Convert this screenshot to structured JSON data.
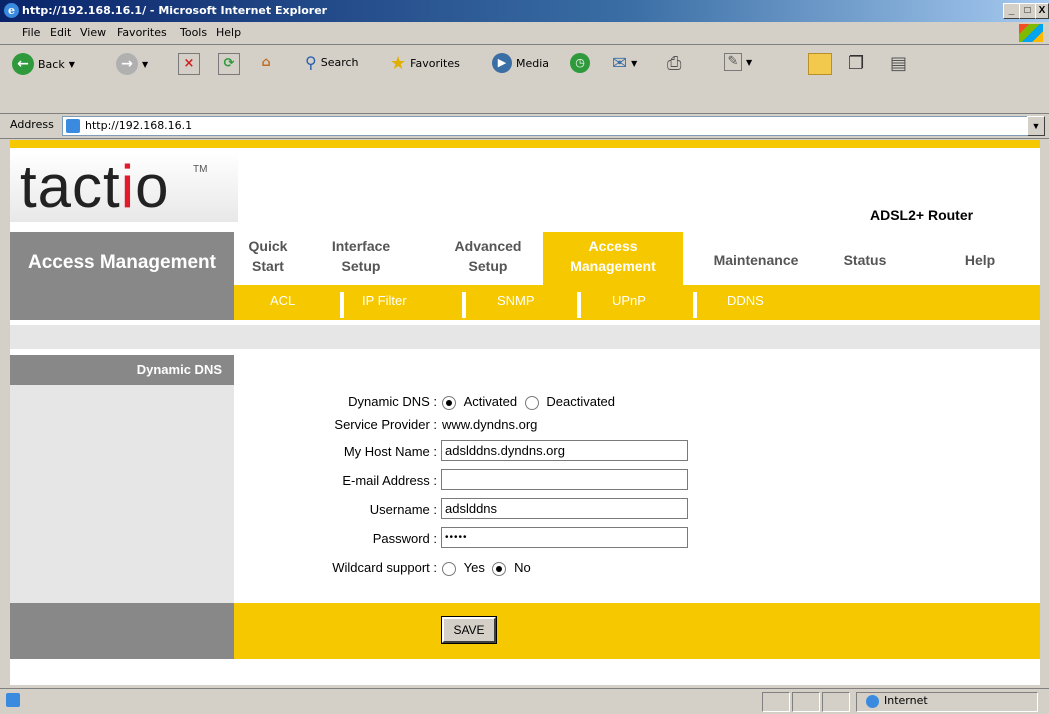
{
  "window": {
    "title": "http://192.168.16.1/ - Microsoft Internet Explorer",
    "controls": [
      "_",
      "□",
      "X"
    ]
  },
  "menu": [
    "File",
    "Edit",
    "View",
    "Favorites",
    "Tools",
    "Help"
  ],
  "toolbar": {
    "back": "Back",
    "search": "Search",
    "favorites": "Favorites",
    "media": "Media"
  },
  "address": {
    "label": "Address",
    "url": "http://192.168.16.1"
  },
  "router": {
    "logo_pre": "tact",
    "logo_i": "i",
    "logo_post": "o",
    "tm": "TM",
    "product": "ADSL2+ Router"
  },
  "nav": {
    "section_title": "Access Management",
    "tabs": [
      {
        "line1": "Quick",
        "line2": "Start"
      },
      {
        "line1": "Interface",
        "line2": "Setup"
      },
      {
        "line1": "Advanced",
        "line2": "Setup"
      },
      {
        "line1": "Access",
        "line2": "Management"
      },
      {
        "line1": "Maintenance",
        "line2": ""
      },
      {
        "line1": "Status",
        "line2": ""
      },
      {
        "line1": "Help",
        "line2": ""
      }
    ],
    "subtabs": [
      "ACL",
      "IP Filter",
      "SNMP",
      "UPnP",
      "DDNS"
    ]
  },
  "section": {
    "heading": "Dynamic DNS"
  },
  "form": {
    "dynamic_dns_label": "Dynamic DNS :",
    "activated": "Activated",
    "deactivated": "Deactivated",
    "service_provider_label": "Service Provider :",
    "service_provider_value": "www.dyndns.org",
    "host_label": "My Host Name :",
    "host_value": "adslddns.dyndns.org",
    "email_label": "E-mail Address :",
    "email_value": "",
    "username_label": "Username :",
    "username_value": "adslddns",
    "password_label": "Password :",
    "password_value": "•••••",
    "wildcard_label": "Wildcard support :",
    "yes": "Yes",
    "no": "No",
    "save": "SAVE"
  },
  "status": {
    "zone": "Internet"
  }
}
